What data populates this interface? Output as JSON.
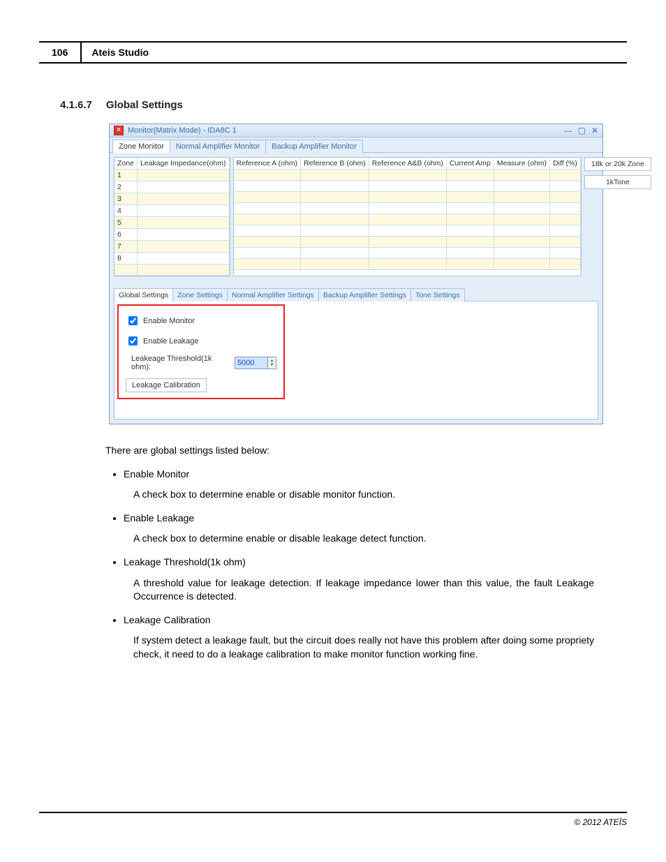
{
  "header": {
    "page_number": "106",
    "title": "Ateis Studio"
  },
  "section": {
    "number": "4.1.6.7",
    "title": "Global Settings"
  },
  "app": {
    "title": "Monitor(Matrix Mode) - IDA8C 1",
    "icon_glyph": "✕",
    "win_min": "—",
    "win_max": "▢",
    "win_close": "✕",
    "top_tabs": [
      "Zone Monitor",
      "Normal Amplifier Monitor",
      "Backup Amplifier Monitor"
    ],
    "zone_cols": [
      "Zone",
      "Leakage Impedance(ohm)"
    ],
    "ref_cols": [
      "Reference A (ohm)",
      "Reference B (ohm)",
      "Reference A&B (ohm)",
      "Current Amp",
      "Measure (ohm)",
      "Diff (%)"
    ],
    "zone_rows": [
      "1",
      "2",
      "3",
      "4",
      "5",
      "6",
      "7",
      "8",
      ""
    ],
    "side_buttons": [
      "18k or 20k Zone",
      "1kTone"
    ],
    "settings_tabs": [
      "Global Settings",
      "Zone Settings",
      "Normal Amplifier Settings",
      "Backup Amplifier Settings",
      "Tone Settings"
    ],
    "enable_monitor_label": "Enable Monitor",
    "enable_leakage_label": "Enable Leakage",
    "threshold_label": "Leakeage Threshold(1k ohm):",
    "threshold_value": "5000",
    "calib_label": "Leakage Calibration"
  },
  "text": {
    "intro": "There are global settings listed below:",
    "items": [
      {
        "t": "Enable Monitor",
        "d": "A check box to determine enable or disable monitor function."
      },
      {
        "t": "Enable Leakage",
        "d": "A check box to determine enable or disable leakage detect function."
      },
      {
        "t": "Leakage Threshold(1k ohm)",
        "d": "A threshold value for leakage detection. If leakage impedance lower than this value, the fault Leakage Occurrence is detected."
      },
      {
        "t": "Leakage Calibration",
        "d": "If system detect a leakage fault, but the circuit does really not have this problem after doing some propriety check, it need to do a leakage calibration to make monitor function working fine."
      }
    ]
  },
  "footer": "© 2012 ATEÏS"
}
